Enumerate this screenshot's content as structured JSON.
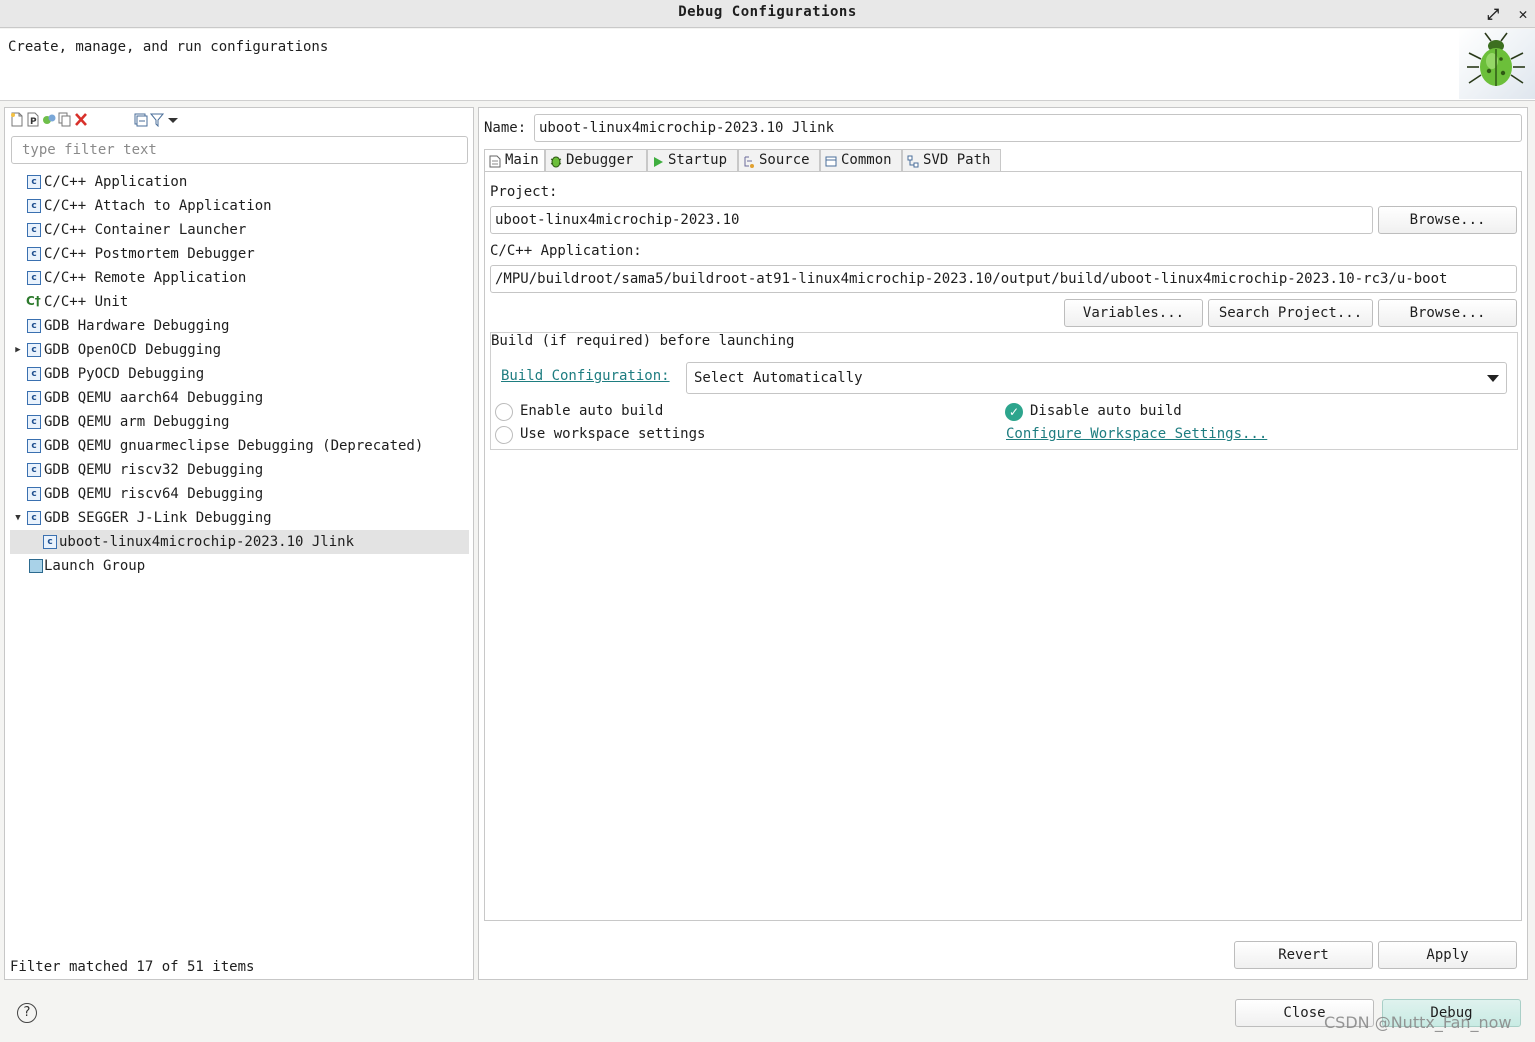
{
  "window": {
    "title": "Debug Configurations",
    "maximize_icon": "⤢",
    "close_icon": "✕"
  },
  "header": {
    "description": "Create, manage, and run configurations",
    "banner_icon": "bug-icon"
  },
  "left_panel": {
    "toolbar_icons": [
      "new-config-icon",
      "new-prototype-icon",
      "export-icon",
      "duplicate-icon",
      "delete-icon",
      "collapse-all-icon",
      "filter-icon",
      "view-menu-chevron-icon"
    ],
    "filter_placeholder": "type filter text",
    "tree": [
      {
        "label": "C/C++ Application",
        "icon": "c"
      },
      {
        "label": "C/C++ Attach to Application",
        "icon": "c"
      },
      {
        "label": "C/C++ Container Launcher",
        "icon": "c"
      },
      {
        "label": "C/C++ Postmortem Debugger",
        "icon": "c"
      },
      {
        "label": "C/C++ Remote Application",
        "icon": "c"
      },
      {
        "label": "C/C++ Unit",
        "icon": "unit"
      },
      {
        "label": "GDB Hardware Debugging",
        "icon": "c"
      },
      {
        "label": "GDB OpenOCD Debugging",
        "icon": "c",
        "collapsed": true
      },
      {
        "label": "GDB PyOCD Debugging",
        "icon": "c"
      },
      {
        "label": "GDB QEMU aarch64 Debugging",
        "icon": "c"
      },
      {
        "label": "GDB QEMU arm Debugging",
        "icon": "c"
      },
      {
        "label": "GDB QEMU gnuarmeclipse Debugging (Deprecated)",
        "icon": "c"
      },
      {
        "label": "GDB QEMU riscv32 Debugging",
        "icon": "c"
      },
      {
        "label": "GDB QEMU riscv64 Debugging",
        "icon": "c"
      },
      {
        "label": "GDB SEGGER J-Link Debugging",
        "icon": "c",
        "expanded": true
      },
      {
        "label": "uboot-linux4microchip-2023.10 Jlink",
        "icon": "c",
        "child": true,
        "selected": true
      },
      {
        "label": "Launch Group",
        "icon": "launch"
      }
    ],
    "status": "Filter matched 17 of 51 items"
  },
  "right_panel": {
    "name_label": "Name:",
    "name_value": "uboot-linux4microchip-2023.10 Jlink",
    "tabs": [
      {
        "label": "Main",
        "icon": "main-tab-icon",
        "active": true
      },
      {
        "label": "Debugger",
        "icon": "debugger-tab-icon"
      },
      {
        "label": "Startup",
        "icon": "startup-tab-icon"
      },
      {
        "label": "Source",
        "icon": "source-tab-icon"
      },
      {
        "label": "Common",
        "icon": "common-tab-icon"
      },
      {
        "label": "SVD Path",
        "icon": "svd-path-tab-icon"
      }
    ],
    "main": {
      "project_label": "Project:",
      "project_value": "uboot-linux4microchip-2023.10",
      "project_browse": "Browse...",
      "app_label": "C/C++ Application:",
      "app_value": "/MPU/buildroot/sama5/buildroot-at91-linux4microchip-2023.10/output/build/uboot-linux4microchip-2023.10-rc3/u-boot",
      "variables_button": "Variables...",
      "search_project_button": "Search Project...",
      "app_browse": "Browse...",
      "build_group_title": "Build (if required) before launching",
      "build_config_link": "Build Configuration:",
      "build_config_value": "Select Automatically",
      "enable_auto_build": "Enable auto build",
      "disable_auto_build": "Disable auto build",
      "use_workspace_settings": "Use workspace settings",
      "configure_workspace_link": "Configure Workspace Settings...",
      "selected_build_option": "Disable auto build"
    },
    "revert_button": "Revert",
    "apply_button": "Apply"
  },
  "footer": {
    "help_label": "?",
    "close_button": "Close",
    "debug_button": "Debug",
    "watermark": "CSDN @Nuttx_Fan_now"
  },
  "colors": {
    "link": "#1e7d80",
    "check": "#2da58d",
    "primary_button": "#c9ebe4",
    "selected_row": "#e3e3e3"
  }
}
